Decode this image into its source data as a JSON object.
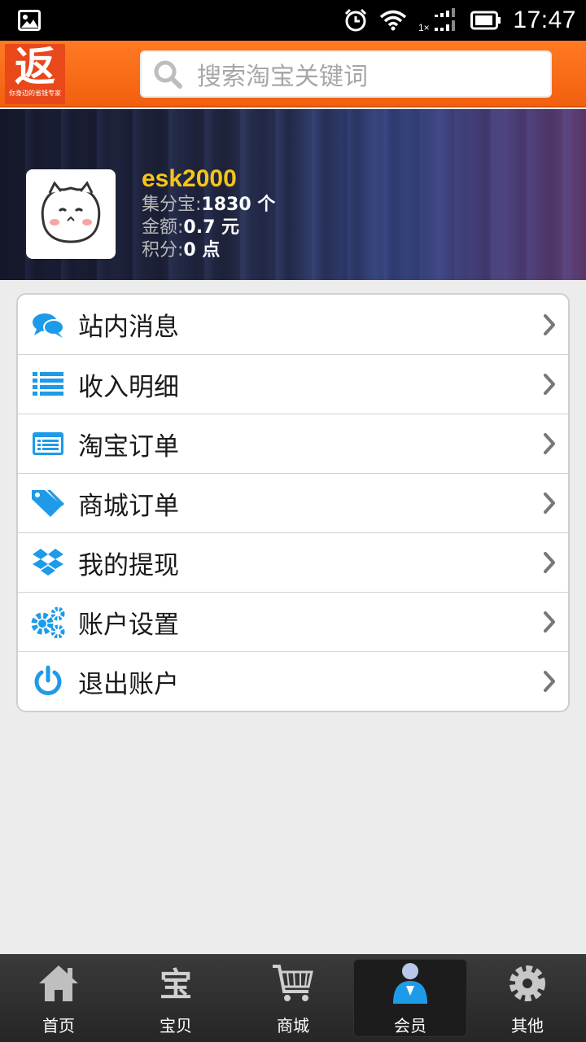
{
  "status_bar": {
    "time": "17:47",
    "icons": [
      "image-notification-icon",
      "alarm-icon",
      "wifi-icon",
      "signal-icon",
      "battery-icon"
    ]
  },
  "header": {
    "logo_char": "返",
    "logo_slogan": "你身边的省钱专家",
    "search_placeholder": "搜索淘宝关键词"
  },
  "profile": {
    "username": "esk2000",
    "jifenbao_label": "集分宝:",
    "jifenbao_value": "1830 个",
    "amount_label": "金额:",
    "amount_value": "0.7 元",
    "points_label": "积分:",
    "points_value": "0 点"
  },
  "menu": {
    "items": [
      {
        "label": "站内消息",
        "icon": "chat-bubbles-icon"
      },
      {
        "label": "收入明细",
        "icon": "list-icon"
      },
      {
        "label": "淘宝订单",
        "icon": "order-card-icon"
      },
      {
        "label": "商城订单",
        "icon": "tags-icon"
      },
      {
        "label": "我的提现",
        "icon": "dropbox-icon"
      },
      {
        "label": "账户设置",
        "icon": "gears-icon"
      },
      {
        "label": "退出账户",
        "icon": "power-icon"
      }
    ]
  },
  "bottom_nav": {
    "items": [
      {
        "label": "首页",
        "icon": "home-icon"
      },
      {
        "label": "宝贝",
        "icon": "bao-icon"
      },
      {
        "label": "商城",
        "icon": "cart-icon"
      },
      {
        "label": "会员",
        "icon": "member-icon",
        "active": true
      },
      {
        "label": "其他",
        "icon": "gear-icon"
      }
    ]
  },
  "colors": {
    "header_orange": "#f2600f",
    "username_yellow": "#f5c518",
    "icon_blue": "#1e9be8"
  }
}
